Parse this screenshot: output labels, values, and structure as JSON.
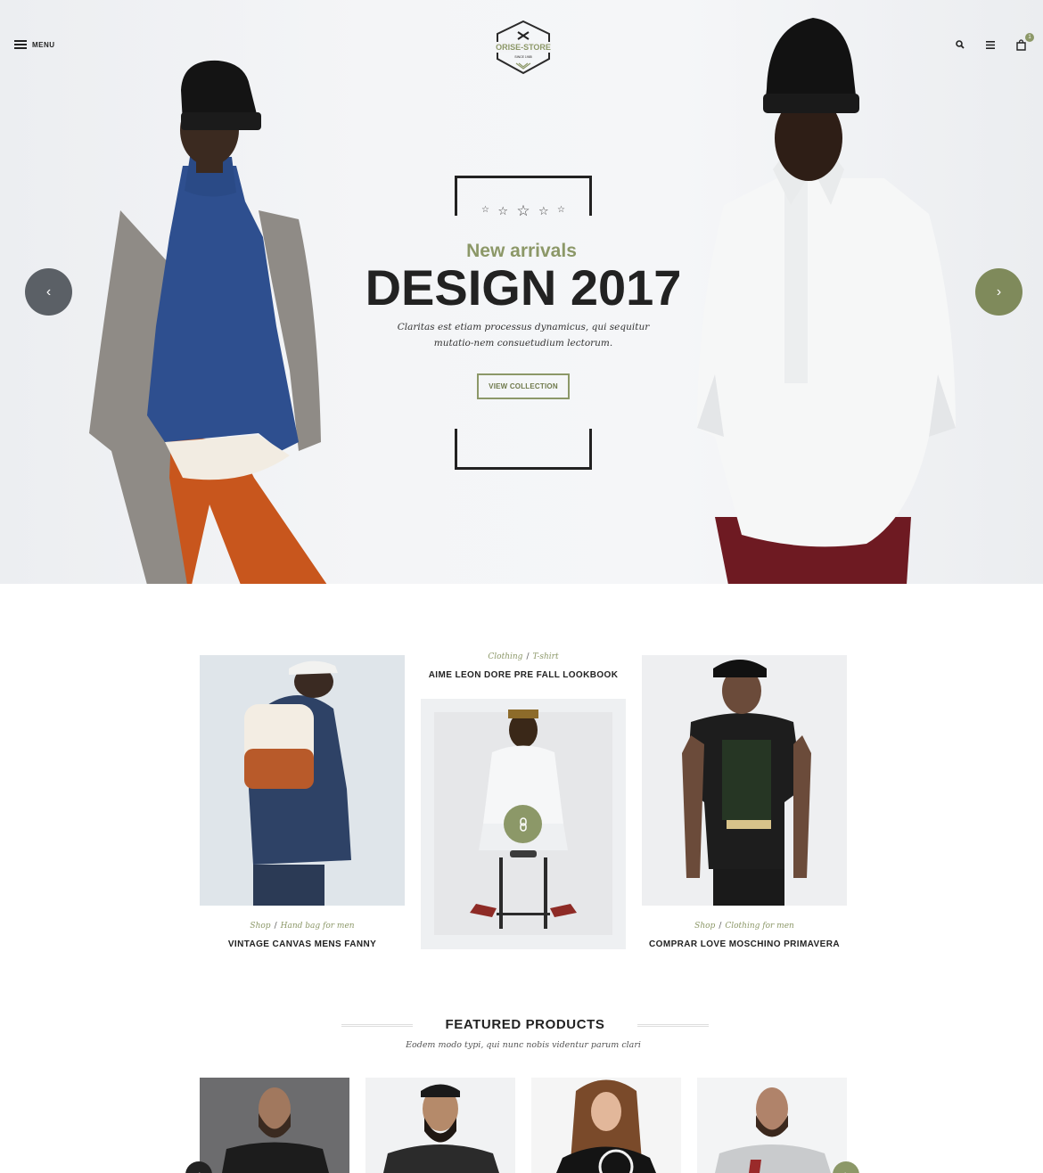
{
  "header": {
    "menu_label": "MENU",
    "logo": {
      "name": "ORISE-STORE",
      "tagline": "SINCE 1985"
    },
    "cart_count": "1",
    "icons": [
      "menu-icon",
      "search-icon",
      "list-icon",
      "shopping-bag-icon"
    ]
  },
  "hero": {
    "subtitle": "New arrivals",
    "title": "DESIGN 2017",
    "description": "Claritas est etiam processus dynamicus, qui sequitur mutatio-nem consuetudium lectorum.",
    "button_label": "VIEW COLLECTION",
    "prev_label": "‹",
    "next_label": "›"
  },
  "lookbook": {
    "items": [
      {
        "cat": "Shop",
        "sub": "Hand bag for men",
        "title": "VINTAGE CANVAS MENS FANNY"
      },
      {
        "cat": "Clothing",
        "sub": "T-shirt",
        "title": "AIME LEON DORE PRE FALL LOOKBOOK"
      },
      {
        "cat": "Shop",
        "sub": "Clothing for men",
        "title": "COMPRAR LOVE MOSCHINO PRIMAVERA"
      }
    ],
    "separator": "/"
  },
  "featured": {
    "title": "FEATURED PRODUCTS",
    "subtitle": "Eodem modo typi, qui nunc nobis videntur parum clari",
    "prev_label": "‹",
    "next_label": "›"
  },
  "colors": {
    "accent": "#8c9868",
    "text": "#222222",
    "hero_bg": "#f2f3f5"
  }
}
